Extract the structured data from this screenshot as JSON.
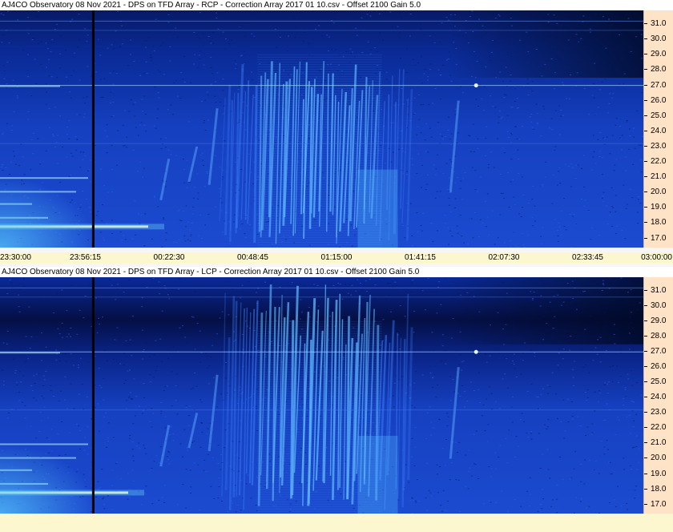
{
  "panels": [
    {
      "title": "AJ4CO Observatory 08 Nov 2021  -  DPS on TFD Array  -  RCP  -  Correction Array 2017 01 10.csv  -  Offset 2100  Gain 5.0"
    },
    {
      "title": "AJ4CO Observatory 08 Nov 2021  -  DPS on TFD Array  -  LCP  -  Correction Array 2017 01 10.csv  -  Offset 2100  Gain 5.0"
    }
  ],
  "time_axis": {
    "ticks": [
      "23:30:00",
      "23:56:15",
      "00:22:30",
      "00:48:45",
      "01:15:00",
      "01:41:15",
      "02:07:30",
      "02:33:45",
      "03:00:00"
    ]
  },
  "chart_data": [
    {
      "type": "heatmap",
      "title": "AJ4CO Observatory 08 Nov 2021  -  DPS on TFD Array  -  RCP  -  Correction Array 2017 01 10.csv  -  Offset 2100  Gain 5.0",
      "x_ticks": [
        "23:30:00",
        "23:56:15",
        "00:22:30",
        "00:48:45",
        "01:15:00",
        "01:41:15",
        "02:07:30",
        "02:33:45",
        "03:00:00"
      ],
      "y_ticks": [
        17.0,
        18.0,
        19.0,
        20.0,
        21.0,
        22.0,
        23.0,
        24.0,
        25.0,
        26.0,
        27.0,
        28.0,
        29.0,
        30.0,
        31.0
      ],
      "ylim": [
        16.4,
        31.9
      ],
      "marker_time": "23:56:15",
      "colors": {
        "low": "#05103f",
        "mid": "#1d49d8",
        "high": "#7fd8ff"
      }
    },
    {
      "type": "heatmap",
      "title": "AJ4CO Observatory 08 Nov 2021  -  DPS on TFD Array  -  LCP  -  Correction Array 2017 01 10.csv  -  Offset 2100  Gain 5.0",
      "x_ticks": [
        "23:30:00",
        "23:56:15",
        "00:22:30",
        "00:48:45",
        "01:15:00",
        "01:41:15",
        "02:07:30",
        "02:33:45",
        "03:00:00"
      ],
      "y_ticks": [
        17.0,
        18.0,
        19.0,
        20.0,
        21.0,
        22.0,
        23.0,
        24.0,
        25.0,
        26.0,
        27.0,
        28.0,
        29.0,
        30.0,
        31.0
      ],
      "ylim": [
        16.4,
        31.9
      ],
      "marker_time": "23:56:15",
      "colors": {
        "low": "#05103f",
        "mid": "#1d49d8",
        "high": "#7fd8ff"
      }
    }
  ]
}
